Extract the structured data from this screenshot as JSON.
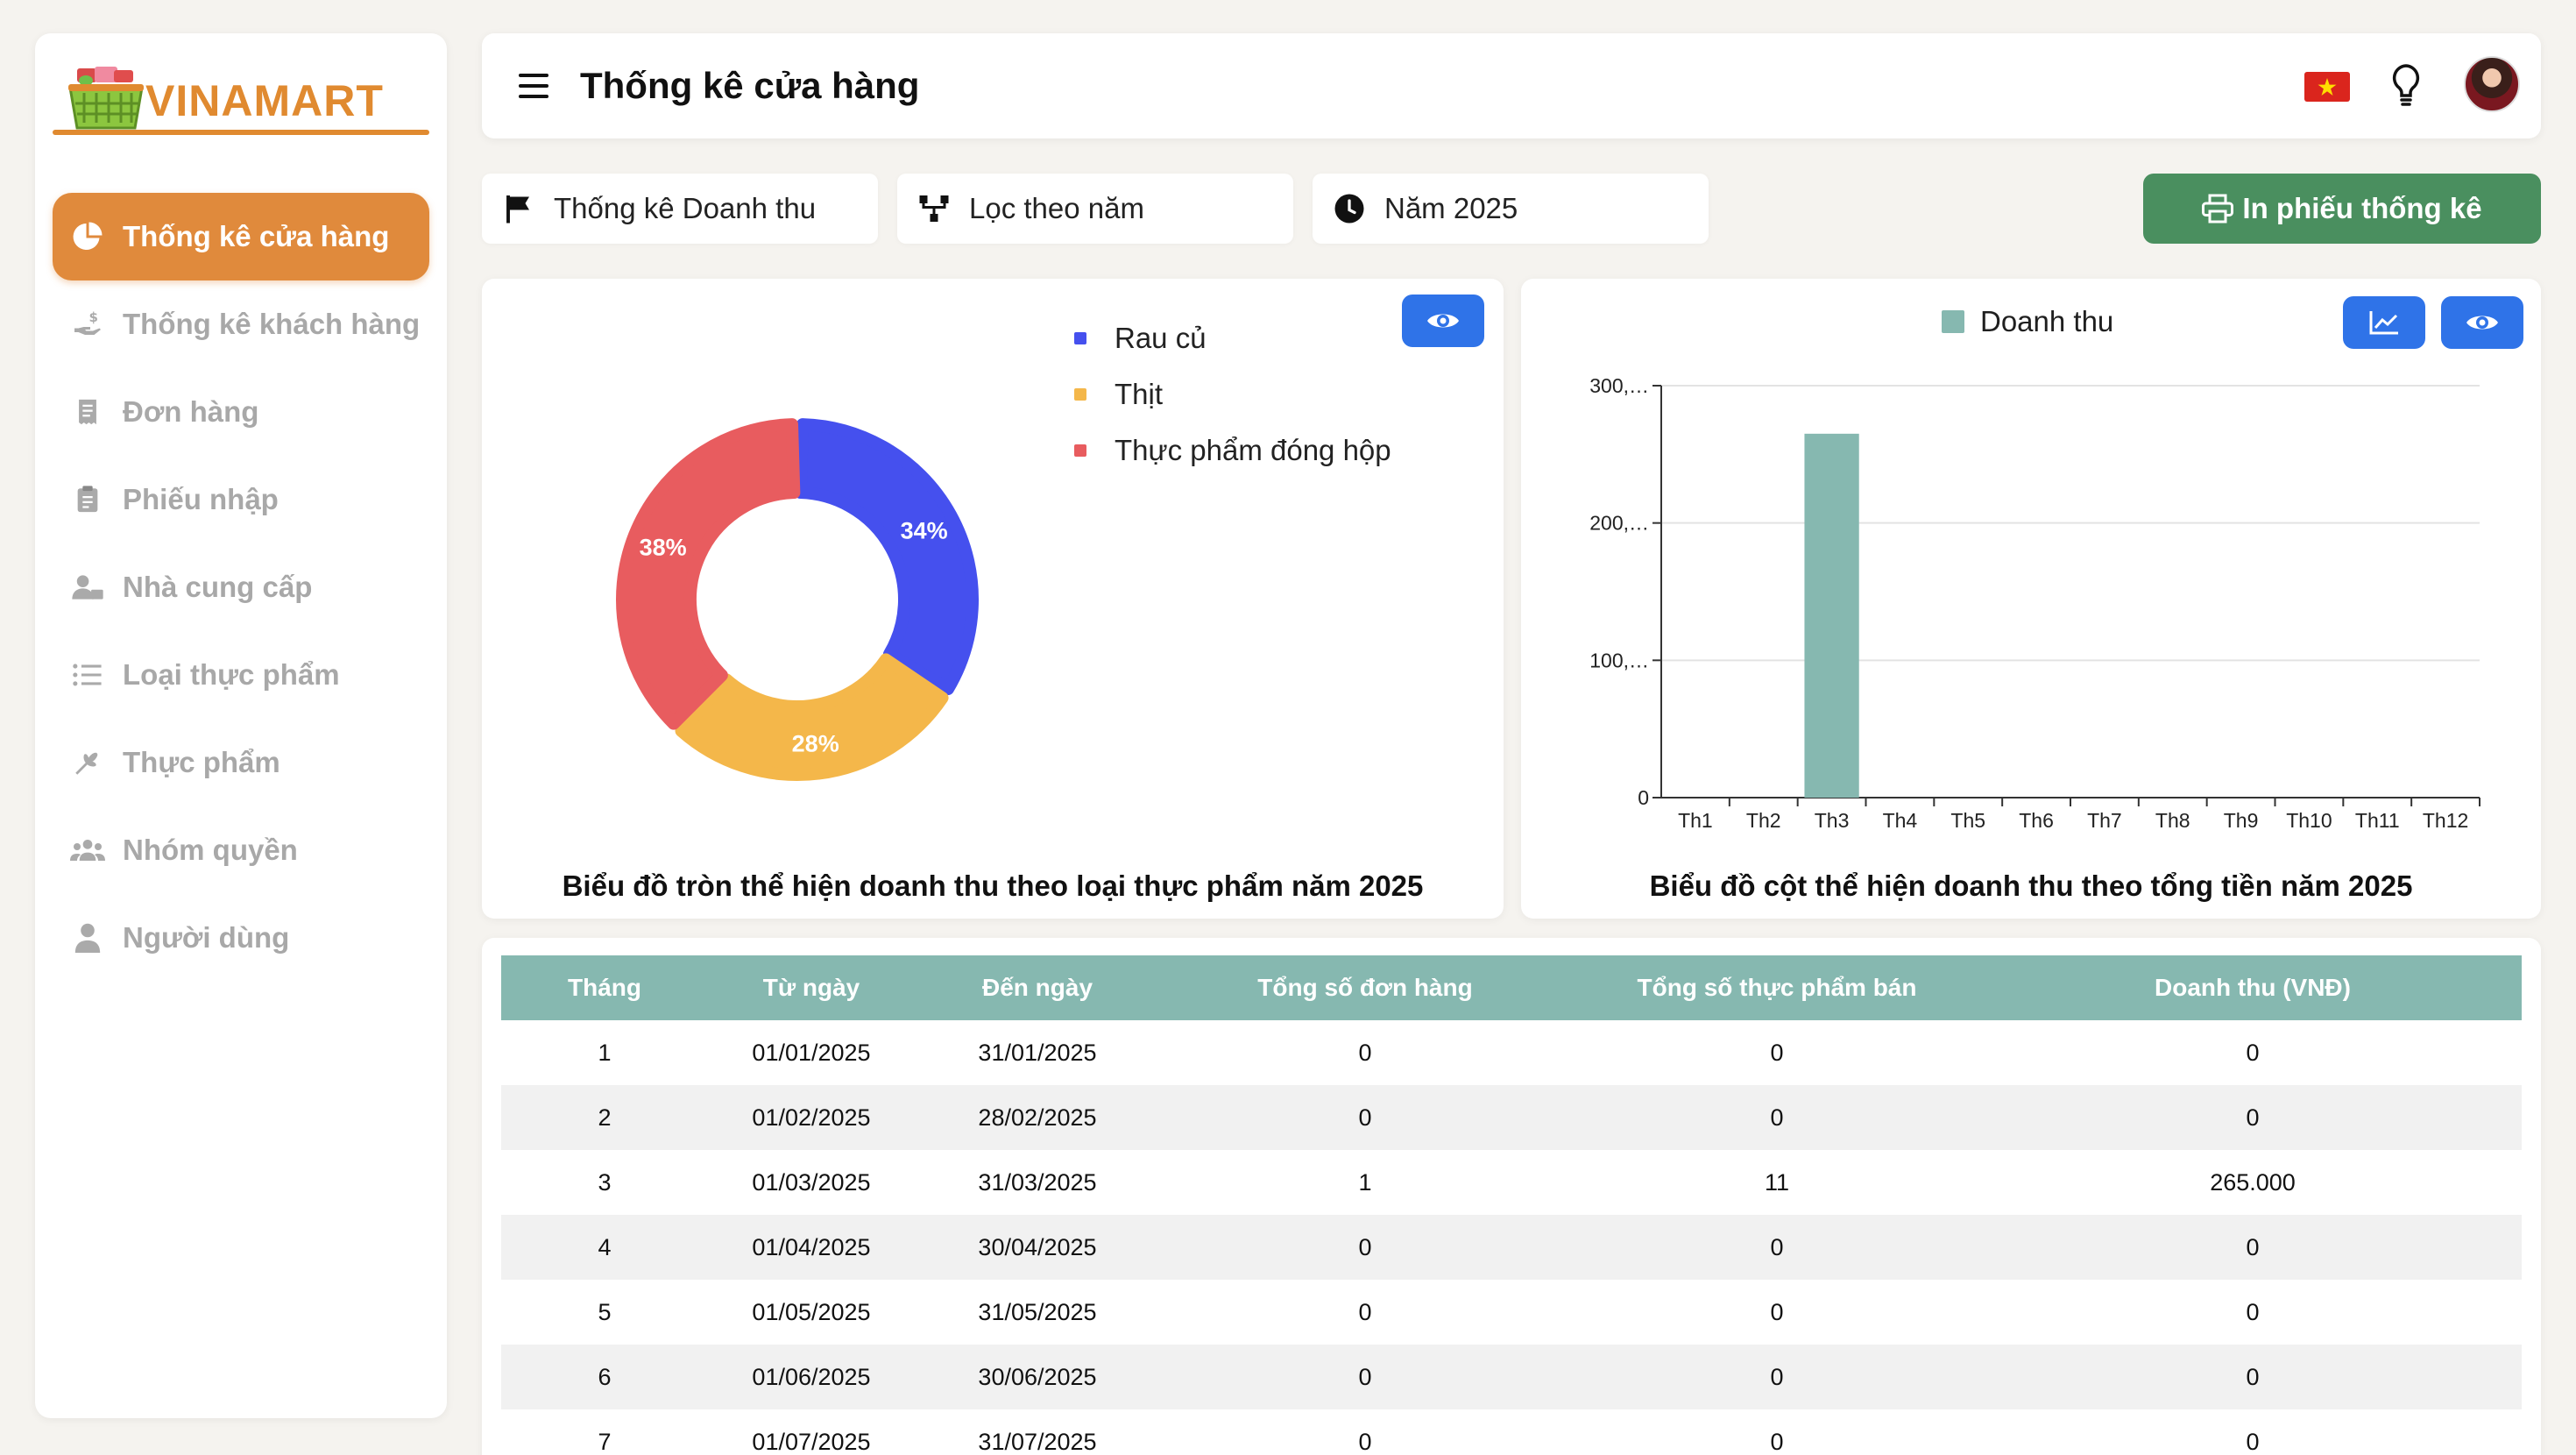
{
  "brand": {
    "name": "VINAMART"
  },
  "sidebar": {
    "items": [
      {
        "label": "Thống kê cửa hàng",
        "icon": "pie-chart-icon",
        "active": true
      },
      {
        "label": "Thống kê khách hàng",
        "icon": "hand-money-icon"
      },
      {
        "label": "Đơn hàng",
        "icon": "receipt-icon"
      },
      {
        "label": "Phiếu nhập",
        "icon": "clipboard-icon"
      },
      {
        "label": "Nhà cung cấp",
        "icon": "supplier-icon"
      },
      {
        "label": "Loại thực phẩm",
        "icon": "list-icon"
      },
      {
        "label": "Thực phẩm",
        "icon": "wheat-icon"
      },
      {
        "label": "Nhóm quyền",
        "icon": "group-icon"
      },
      {
        "label": "Người dùng",
        "icon": "user-icon"
      }
    ]
  },
  "header": {
    "title": "Thống kê cửa hàng"
  },
  "filters": {
    "type": "Thống kê Doanh thu",
    "mode": "Lọc theo năm",
    "year": "Năm 2025",
    "print_label": "In phiếu thống kê"
  },
  "pie": {
    "caption": "Biểu đồ tròn thể hiện doanh thu theo loại thực phẩm năm 2025",
    "legend": [
      "Rau củ",
      "Thịt",
      "Thực phẩm đóng hộp"
    ]
  },
  "bar": {
    "caption": "Biểu đồ cột thể hiện doanh thu theo tổng tiền năm 2025",
    "legend": "Doanh thu"
  },
  "chart_data": [
    {
      "type": "pie",
      "categories": [
        "Rau củ",
        "Thịt",
        "Thực phẩm đóng hộp"
      ],
      "values": [
        34,
        28,
        38
      ],
      "value_labels": [
        "34%",
        "28%",
        "38%"
      ],
      "colors": [
        "#4550ee",
        "#f4b74a",
        "#e85c5f"
      ],
      "title": "Biểu đồ tròn thể hiện doanh thu theo loại thực phẩm năm 2025"
    },
    {
      "type": "bar",
      "categories": [
        "Th1",
        "Th2",
        "Th3",
        "Th4",
        "Th5",
        "Th6",
        "Th7",
        "Th8",
        "Th9",
        "Th10",
        "Th11",
        "Th12"
      ],
      "series": [
        {
          "name": "Doanh thu",
          "values": [
            0,
            0,
            265000,
            0,
            0,
            0,
            0,
            0,
            0,
            0,
            0,
            0
          ],
          "color": "#86b8b0"
        }
      ],
      "ylim": [
        0,
        300000
      ],
      "yticks": [
        0,
        100000,
        200000,
        300000
      ],
      "ytick_labels": [
        "0",
        "100,…",
        "200,…",
        "300,…"
      ],
      "grid": true,
      "title": "Biểu đồ cột thể hiện doanh thu theo tổng tiền năm 2025"
    }
  ],
  "table": {
    "headers": [
      "Tháng",
      "Từ ngày",
      "Đến ngày",
      "Tổng số đơn hàng",
      "Tổng số thực phẩm bán",
      "Doanh thu (VNĐ)"
    ],
    "rows": [
      [
        "1",
        "01/01/2025",
        "31/01/2025",
        "0",
        "0",
        "0"
      ],
      [
        "2",
        "01/02/2025",
        "28/02/2025",
        "0",
        "0",
        "0"
      ],
      [
        "3",
        "01/03/2025",
        "31/03/2025",
        "1",
        "11",
        "265.000"
      ],
      [
        "4",
        "01/04/2025",
        "30/04/2025",
        "0",
        "0",
        "0"
      ],
      [
        "5",
        "01/05/2025",
        "31/05/2025",
        "0",
        "0",
        "0"
      ],
      [
        "6",
        "01/06/2025",
        "30/06/2025",
        "0",
        "0",
        "0"
      ],
      [
        "7",
        "01/07/2025",
        "31/07/2025",
        "0",
        "0",
        "0"
      ]
    ]
  }
}
